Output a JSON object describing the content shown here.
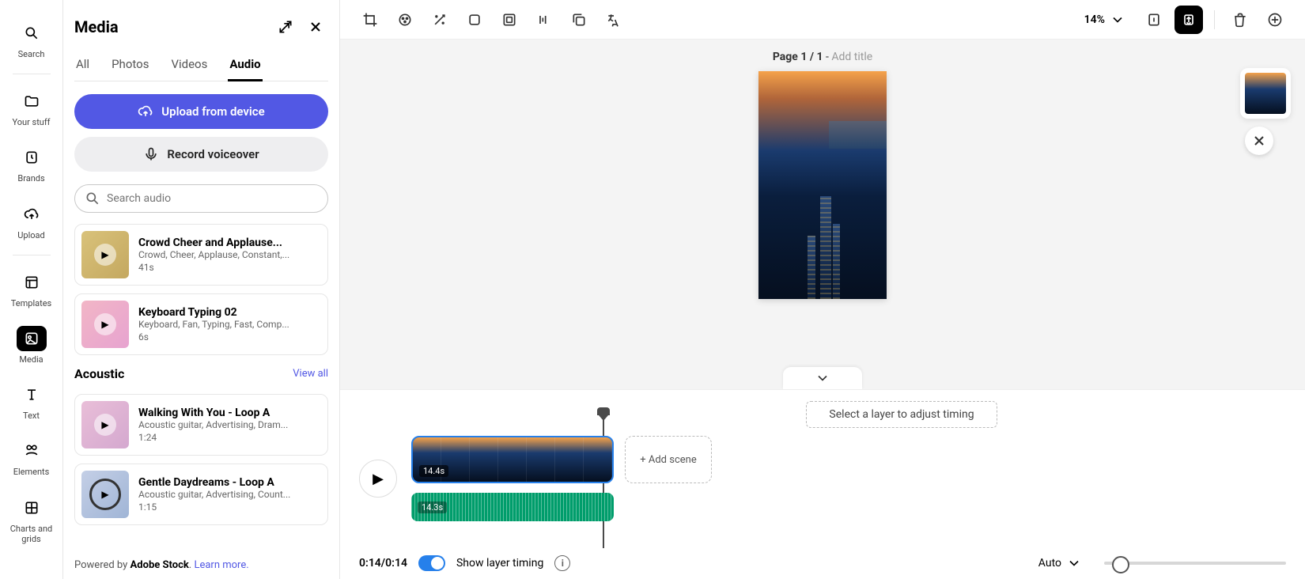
{
  "rail": {
    "search": "Search",
    "your_stuff": "Your stuff",
    "brands": "Brands",
    "upload": "Upload",
    "templates": "Templates",
    "media": "Media",
    "text": "Text",
    "elements": "Elements",
    "charts": "Charts and grids"
  },
  "panel": {
    "title": "Media",
    "tabs": {
      "all": "All",
      "photos": "Photos",
      "videos": "Videos",
      "audio": "Audio"
    },
    "upload_btn": "Upload from device",
    "record_btn": "Record voiceover",
    "search_placeholder": "Search audio",
    "items": [
      {
        "title": "Crowd Cheer and Applause...",
        "tags": "Crowd, Cheer, Applause, Constant,...",
        "dur": "41s"
      },
      {
        "title": "Keyboard Typing 02",
        "tags": "Keyboard, Fan, Typing, Fast, Comp...",
        "dur": "6s"
      }
    ],
    "section": {
      "title": "Acoustic",
      "view_all": "View all"
    },
    "items2": [
      {
        "title": "Walking With You - Loop A",
        "tags": "Acoustic guitar, Advertising, Dram...",
        "dur": "1:24"
      },
      {
        "title": "Gentle Daydreams - Loop A",
        "tags": "Acoustic guitar, Advertising, Count...",
        "dur": "1:15"
      }
    ],
    "powered_prefix": "Powered by ",
    "powered_brand": "Adobe Stock",
    "powered_dot": ". ",
    "learn_more": "Learn more."
  },
  "toolbar": {
    "zoom": "14%"
  },
  "canvas": {
    "page_prefix": "Page ",
    "page_current": "1 / 1",
    "page_sep": " - ",
    "add_title": "Add title"
  },
  "timeline": {
    "hint": "Select a layer to adjust timing",
    "scene_duration": "14.4s",
    "audio_duration": "14.3s",
    "add_scene": "+ Add scene",
    "time": "0:14/0:14",
    "show_layer": "Show layer timing",
    "auto": "Auto"
  }
}
